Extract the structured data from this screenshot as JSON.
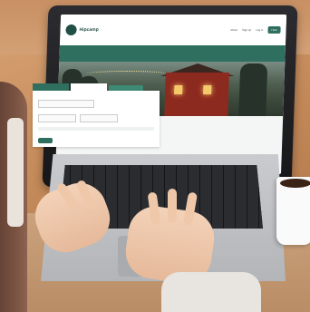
{
  "screen": {
    "logo_text": "Hipcamp",
    "nav": [
      "About",
      "Sign up",
      "Log in"
    ],
    "nav_cta": "Host"
  },
  "icons": [
    "logo-icon"
  ]
}
